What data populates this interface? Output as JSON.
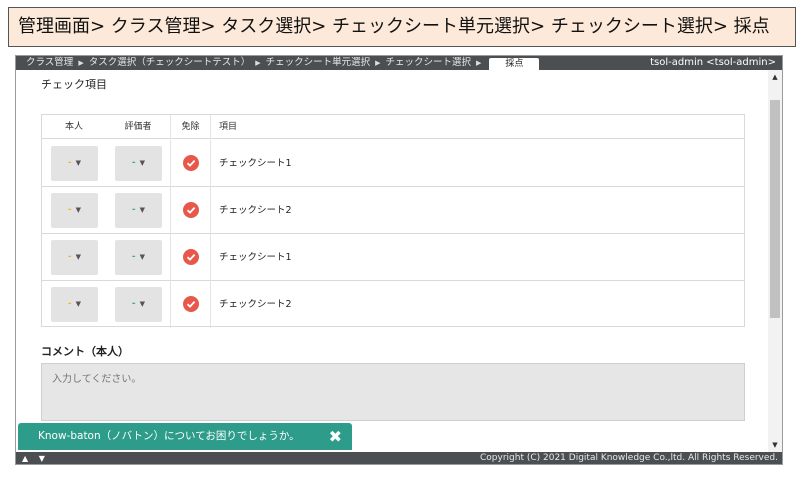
{
  "banner": {
    "title": "管理画面> クラス管理> タスク選択> チェックシート単元選択> チェックシート選択> 採点"
  },
  "topbar": {
    "breadcrumbs": [
      "クラス管理",
      "タスク選択（チェックシートテスト）",
      "チェックシート単元選択",
      "チェックシート選択"
    ],
    "current": "採点",
    "user": "tsol-admin <tsol-admin>"
  },
  "section": {
    "heading": "チェック項目"
  },
  "table": {
    "headers": [
      "本人",
      "評価者",
      "免除",
      "項目"
    ],
    "rows": [
      {
        "self": "-",
        "evaluator": "-",
        "item": "チェックシート1"
      },
      {
        "self": "-",
        "evaluator": "-",
        "item": "チェックシート2"
      },
      {
        "self": "-",
        "evaluator": "-",
        "item": "チェックシート1"
      },
      {
        "self": "-",
        "evaluator": "-",
        "item": "チェックシート2"
      }
    ]
  },
  "comment": {
    "heading": "コメント（本人）",
    "placeholder": "入力してください。"
  },
  "footer": {
    "arrows": "▲ ▼",
    "copyright": "Copyright (C) 2021 Digital Knowledge Co.,ltd. All Rights Reserved."
  },
  "toast": {
    "text": "Know-baton（ノバトン）についてお困りでしょうか。",
    "close": "✖"
  },
  "colors": {
    "banner_bg": "#fde9d9",
    "bar_bg": "#4c4f52",
    "check_red": "#e8584a",
    "toast_teal": "#2e9c8a",
    "dash_orange": "#f2b23a",
    "dash_green": "#3bb56c"
  }
}
